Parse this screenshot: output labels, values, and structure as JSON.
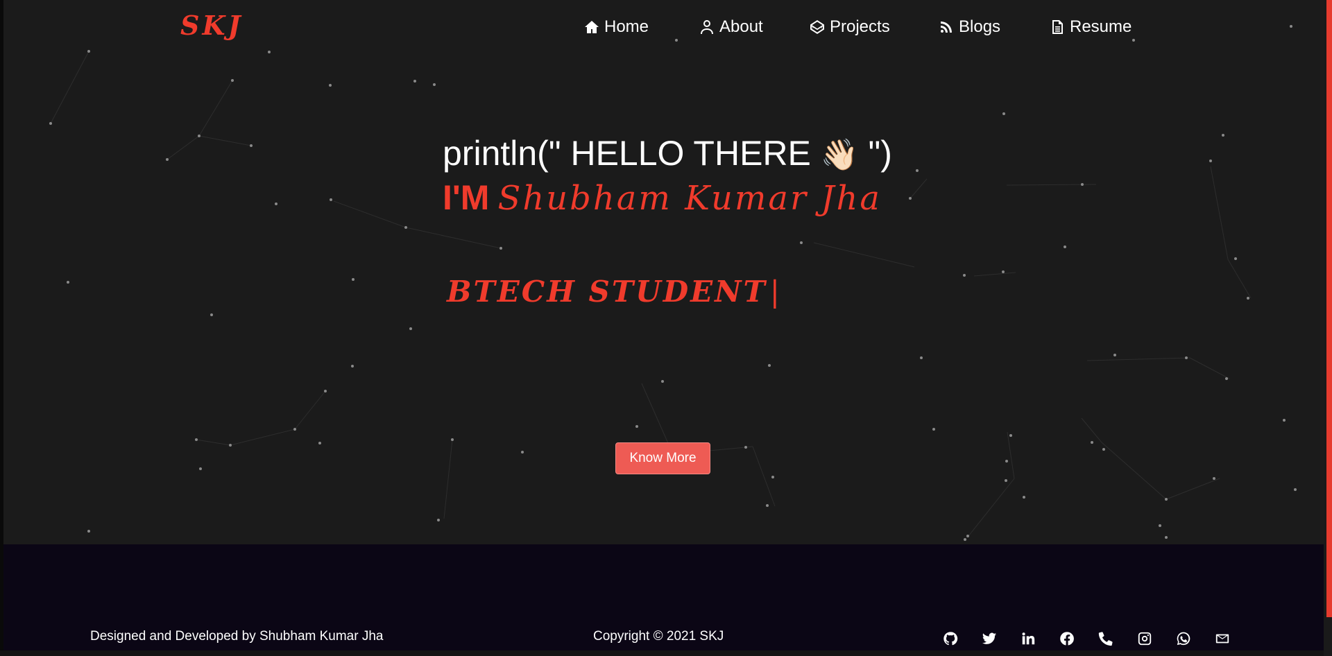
{
  "brand": {
    "logo": "SKJ",
    "accent_color": "#f03b2c"
  },
  "nav": {
    "items": [
      {
        "label": "Home",
        "icon": "home-icon"
      },
      {
        "label": "About",
        "icon": "user-icon"
      },
      {
        "label": "Projects",
        "icon": "codepen-icon"
      },
      {
        "label": "Blogs",
        "icon": "blog-icon"
      },
      {
        "label": "Resume",
        "icon": "document-icon"
      }
    ]
  },
  "hero": {
    "greeting_prefix": "println(\" HELLO THERE ",
    "greeting_emoji": "👋🏻",
    "greeting_suffix": " \")",
    "im_prefix": "I'M",
    "name": "Shubham Kumar Jha",
    "typed_text": "BTECH STUDENT",
    "cursor": "|",
    "button_label": "Know More"
  },
  "footer": {
    "credit": "Designed and Developed by Shubham Kumar Jha",
    "copyright": "Copyright © 2021 SKJ",
    "social_icons": [
      "github-icon",
      "twitter-icon",
      "linkedin-icon",
      "facebook-icon",
      "phone-icon",
      "instagram-icon",
      "whatsapp-icon",
      "mail-icon"
    ]
  }
}
